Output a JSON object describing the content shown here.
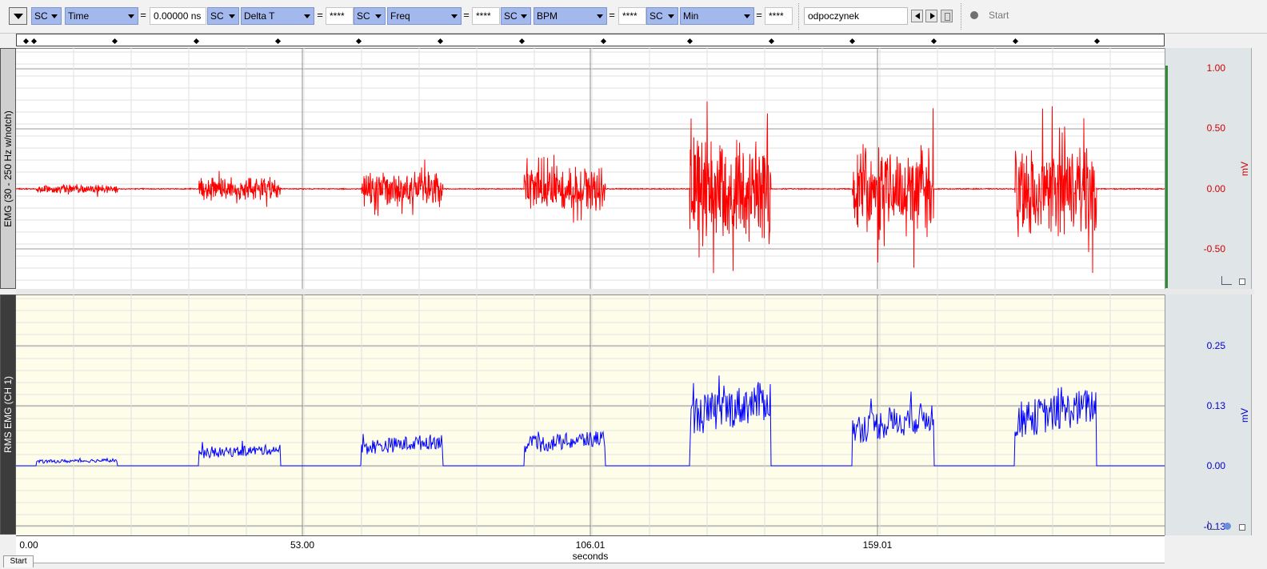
{
  "toolbar": {
    "measurements": [
      {
        "channel": "SC",
        "type": "Time",
        "value": "0.00000 ns"
      },
      {
        "channel": "SC",
        "type": "Delta T",
        "value": "****"
      },
      {
        "channel": "SC",
        "type": "Freq",
        "value": "****"
      },
      {
        "channel": "SC",
        "type": "BPM",
        "value": "****"
      },
      {
        "channel": "SC",
        "type": "Min",
        "value": "****"
      }
    ],
    "equals": "=",
    "event_label": "odpoczynek",
    "start_label": "Start"
  },
  "channels": [
    {
      "label": "EMG (30 - 250 Hz w/notch)",
      "unit": "mV",
      "color": "#ff0000",
      "ticks": [
        "1.00",
        "0.50",
        "0.00",
        "-0.50"
      ]
    },
    {
      "label": "RMS EMG (CH 1)",
      "unit": "mV",
      "color": "#0000ff",
      "ticks": [
        "0.25",
        "0.13",
        "0.00",
        "-0.13"
      ]
    }
  ],
  "x_axis": {
    "ticks": [
      "0.00",
      "53.00",
      "106.01",
      "159.01"
    ],
    "unit": "seconds"
  },
  "bottom_tab": "Start",
  "chart_data": {
    "type": "line",
    "x_unit": "seconds",
    "xlim": [
      -2.2,
      209.6
    ],
    "event_markers_s": [
      -0.5,
      1,
      16,
      31,
      46,
      61,
      76,
      91,
      106,
      122,
      137,
      152,
      167,
      182,
      197
    ],
    "bursts": [
      {
        "start": 1.5,
        "end": 16.5,
        "emg_amplitude_mV": 0.07,
        "rms_mean_mV": 0.01
      },
      {
        "start": 31.5,
        "end": 46.5,
        "emg_amplitude_mV": 0.18,
        "rms_mean_mV": 0.03
      },
      {
        "start": 61.5,
        "end": 76.5,
        "emg_amplitude_mV": 0.28,
        "rms_mean_mV": 0.045
      },
      {
        "start": 91.5,
        "end": 106.5,
        "emg_amplitude_mV": 0.35,
        "rms_mean_mV": 0.05
      },
      {
        "start": 122.0,
        "end": 137.0,
        "emg_amplitude_mV": 0.82,
        "rms_mean_mV": 0.12
      },
      {
        "start": 152.0,
        "end": 167.0,
        "emg_amplitude_mV": 0.68,
        "rms_mean_mV": 0.09
      },
      {
        "start": 182.0,
        "end": 197.0,
        "emg_amplitude_mV": 0.72,
        "rms_mean_mV": 0.11
      }
    ],
    "series": [
      {
        "name": "EMG (30 - 250 Hz w/notch)",
        "ylim": [
          -0.6,
          1.0
        ]
      },
      {
        "name": "RMS EMG (CH 1)",
        "ylim": [
          -0.13,
          0.32
        ]
      }
    ]
  }
}
